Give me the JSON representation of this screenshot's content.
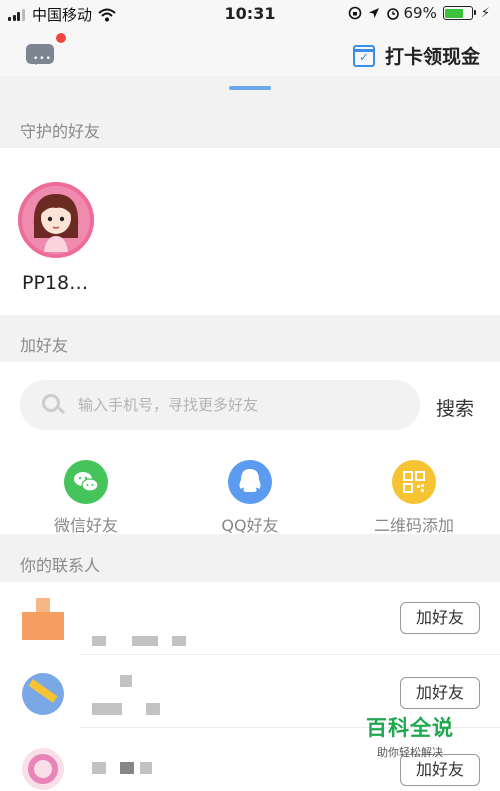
{
  "status_bar": {
    "carrier": "中国移动",
    "time": "10:31",
    "battery": "69%",
    "battery_level": 0.69
  },
  "top_bar": {
    "checkin_label": "打卡领现金"
  },
  "guarded": {
    "title": "守护的好友",
    "friend_name": "PP18…"
  },
  "add_friend": {
    "title": "加好友",
    "search_placeholder": "输入手机号，寻找更多好友",
    "search_button": "搜索",
    "options": [
      {
        "label": "微信好友",
        "icon": "wechat-icon",
        "color": "#44c45a"
      },
      {
        "label": "QQ好友",
        "icon": "qq-icon",
        "color": "#5b9cf0"
      },
      {
        "label": "二维码添加",
        "icon": "qr-code-icon",
        "color": "#f6c433"
      }
    ]
  },
  "contacts": {
    "title": "你的联系人",
    "add_label": "加好友"
  },
  "watermark": {
    "big": "百科全说",
    "small": "助你轻松解决"
  },
  "colors": {
    "accent": "#3a8ee6",
    "badge": "#f0463e",
    "battery": "#3cc13a"
  }
}
